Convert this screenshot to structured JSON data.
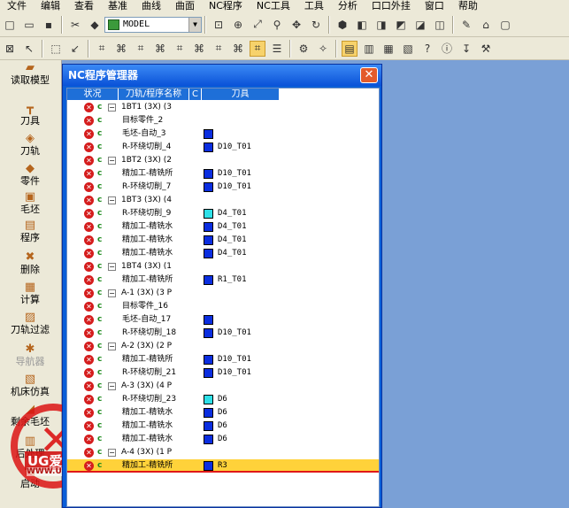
{
  "menu": [
    "文件",
    "编辑",
    "查看",
    "基准",
    "曲线",
    "曲面",
    "NC程序",
    "NC工具",
    "工具",
    "分析",
    "口口外挂",
    "窗口",
    "帮助"
  ],
  "toolbar": {
    "model_combo": "MODEL"
  },
  "left_bar": [
    {
      "label": "读取模型",
      "icon": "folder-icon",
      "disabled": false
    },
    {
      "label": "刀具",
      "icon": "tool-icon",
      "disabled": false
    },
    {
      "label": "刀轨",
      "icon": "toolpath-icon",
      "disabled": false
    },
    {
      "label": "零件",
      "icon": "part-icon",
      "disabled": false
    },
    {
      "label": "毛坯",
      "icon": "stock-icon",
      "disabled": false
    },
    {
      "label": "程序",
      "icon": "program-icon",
      "disabled": false
    },
    {
      "label": "删除",
      "icon": "delete-icon",
      "disabled": false
    },
    {
      "label": "计算",
      "icon": "calculate-icon",
      "disabled": false
    },
    {
      "label": "刀轨过滤",
      "icon": "filter-icon",
      "disabled": false
    },
    {
      "label": "导航器",
      "icon": "navigator-icon",
      "disabled": true
    },
    {
      "label": "机床仿真",
      "icon": "simulate-icon",
      "disabled": false
    },
    {
      "label": "剩余毛坯",
      "icon": "remaining-stock-icon",
      "disabled": false
    },
    {
      "label": "后处理",
      "icon": "post-icon",
      "disabled": false
    },
    {
      "label": "启动",
      "icon": "start-icon",
      "disabled": false
    }
  ],
  "watermark": {
    "logo": "UG爱好者",
    "url": "WWW.UGSNX.COM"
  },
  "nc_window": {
    "title": "NC程序管理器",
    "close_label": "✕",
    "headers": {
      "status": "状况",
      "name": "刀轨/程序名称",
      "c": "C",
      "tool": "刀具"
    },
    "rows": [
      {
        "type": "program",
        "name": "1BT1 (3X) (3",
        "tool": ""
      },
      {
        "type": "child",
        "name": "目标零件_2",
        "color": "",
        "tool": ""
      },
      {
        "type": "child",
        "name": "毛坯-自动_3",
        "color": "#0a2ee0",
        "tool": ""
      },
      {
        "type": "child",
        "name": "R-环绕切削_4",
        "color": "#0a2ee0",
        "tool": "D10_T01"
      },
      {
        "type": "program",
        "name": "1BT2 (3X) (2",
        "tool": ""
      },
      {
        "type": "child",
        "name": "精加工-精铣所",
        "color": "#0a2ee0",
        "tool": "D10_T01"
      },
      {
        "type": "child",
        "name": "R-环绕切削_7",
        "color": "#0a2ee0",
        "tool": "D10_T01"
      },
      {
        "type": "program",
        "name": "1BT3 (3X) (4",
        "tool": ""
      },
      {
        "type": "child",
        "name": "R-环绕切削_9",
        "color": "#2ee0e8",
        "tool": "D4_T01"
      },
      {
        "type": "child",
        "name": "精加工-精铣水",
        "color": "#0a2ee0",
        "tool": "D4_T01"
      },
      {
        "type": "child",
        "name": "精加工-精铣水",
        "color": "#0a2ee0",
        "tool": "D4_T01"
      },
      {
        "type": "child",
        "name": "精加工-精铣水",
        "color": "#0a2ee0",
        "tool": "D4_T01"
      },
      {
        "type": "program",
        "name": "1BT4 (3X) (1",
        "tool": ""
      },
      {
        "type": "child",
        "name": "精加工-精铣所",
        "color": "#0a2ee0",
        "tool": "R1_T01"
      },
      {
        "type": "program",
        "name": "A-1 (3X) (3 P",
        "tool": ""
      },
      {
        "type": "child",
        "name": "目标零件_16",
        "color": "",
        "tool": ""
      },
      {
        "type": "child",
        "name": "毛坯-自动_17",
        "color": "#0a2ee0",
        "tool": ""
      },
      {
        "type": "child",
        "name": "R-环绕切削_18",
        "color": "#0a2ee0",
        "tool": "D10_T01"
      },
      {
        "type": "program",
        "name": "A-2 (3X) (2 P",
        "tool": ""
      },
      {
        "type": "child",
        "name": "精加工-精铣所",
        "color": "#0a2ee0",
        "tool": "D10_T01"
      },
      {
        "type": "child",
        "name": "R-环绕切削_21",
        "color": "#0a2ee0",
        "tool": "D10_T01"
      },
      {
        "type": "program",
        "name": "A-3 (3X) (4 P",
        "tool": ""
      },
      {
        "type": "child",
        "name": "R-环绕切削_23",
        "color": "#2ee0e8",
        "tool": "D6"
      },
      {
        "type": "child",
        "name": "精加工-精铣水",
        "color": "#0a2ee0",
        "tool": "D6"
      },
      {
        "type": "child",
        "name": "精加工-精铣水",
        "color": "#0a2ee0",
        "tool": "D6"
      },
      {
        "type": "child",
        "name": "精加工-精铣水",
        "color": "#0a2ee0",
        "tool": "D6"
      },
      {
        "type": "program",
        "name": "A-4 (3X) (1 P",
        "tool": ""
      },
      {
        "type": "child",
        "name": "精加工-精铣所",
        "color": "#0a2ee0",
        "tool": "R3",
        "selected": true
      }
    ]
  }
}
